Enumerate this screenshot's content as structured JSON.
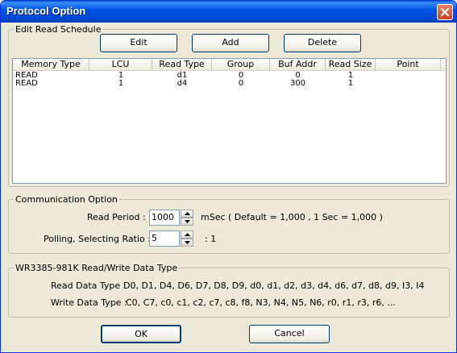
{
  "window": {
    "title": "Protocol Option"
  },
  "edit_group": {
    "legend": "Edit Read Schedule",
    "edit_label": "Edit",
    "add_label": "Add",
    "delete_label": "Delete"
  },
  "table": {
    "columns": [
      "Memory Type",
      "LCU",
      "Read Type",
      "Group",
      "Buf Addr",
      "Read Size",
      "Point"
    ],
    "rows": [
      [
        "READ",
        "1",
        "d1",
        "0",
        "0",
        "1",
        ""
      ],
      [
        "READ",
        "1",
        "d4",
        "0",
        "300",
        "1",
        ""
      ]
    ]
  },
  "comm_group": {
    "legend": "Communication Option",
    "read_period_label": "Read Period :",
    "read_period_value": "1000",
    "read_period_hint": "mSec ( Default = 1,000 ,    1 Sec = 1,000 )",
    "polling_label": "Polling, Selecting Ratio :",
    "polling_value": "5",
    "polling_suffix": ":   1"
  },
  "datatype_group": {
    "legend": "WR3385-981K Read/Write Data Type",
    "read_label": "Read Data Type :",
    "read_value": "D0, D1, D4, D6, D7, D8, D9, d0, d1, d2, d3, d4, d6, d7, d8, d9, I3, I4",
    "write_label": "Write Data Type :",
    "write_value": "C0, C7, c0, c1, c2, c7, c8, f8,  N3, N4, N5, N6, r0, r1, r3, r6, ..."
  },
  "footer": {
    "ok_label": "OK",
    "cancel_label": "Cancel"
  }
}
